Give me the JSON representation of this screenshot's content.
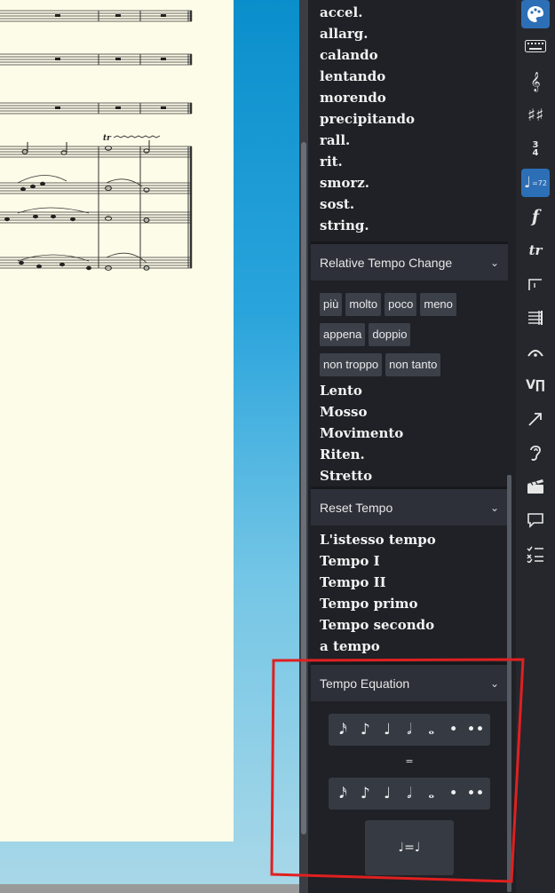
{
  "tempo_change_items": [
    "accel.",
    "allarg.",
    "calando",
    "lentando",
    "morendo",
    "precipitando",
    "rall.",
    "rit.",
    "smorz.",
    "sost.",
    "string."
  ],
  "relative_tempo": {
    "title": "Relative Tempo Change",
    "chips_row1": [
      "più",
      "molto",
      "poco",
      "meno"
    ],
    "chips_row2": [
      "appena",
      "doppio"
    ],
    "chips_row3": [
      "non troppo",
      "non tanto"
    ],
    "items": [
      "Lento",
      "Mosso",
      "Movimento",
      "Riten.",
      "Stretto"
    ]
  },
  "reset_tempo": {
    "title": "Reset Tempo",
    "items": [
      "L'istesso tempo",
      "Tempo I",
      "Tempo II",
      "Tempo primo",
      "Tempo secondo",
      "a tempo"
    ]
  },
  "tempo_equation": {
    "title": "Tempo Equation",
    "note_values": [
      "𝅘𝅥𝅯",
      "♪",
      "♩",
      "𝅗𝅥",
      "𝅝",
      "•",
      "••"
    ],
    "equals": "=",
    "preview": "♩=♩"
  },
  "score": {
    "trill_mark": "tr"
  },
  "toolbar": {
    "tempo_badge": "=72",
    "time_sig_top": "3",
    "time_sig_bottom": "4",
    "dynamic_label": "f",
    "trill_label": "tr"
  },
  "colors": {
    "active_tool": "#2c6fb6",
    "annotation_red": "#e02020",
    "paper": "#fdfce8"
  }
}
